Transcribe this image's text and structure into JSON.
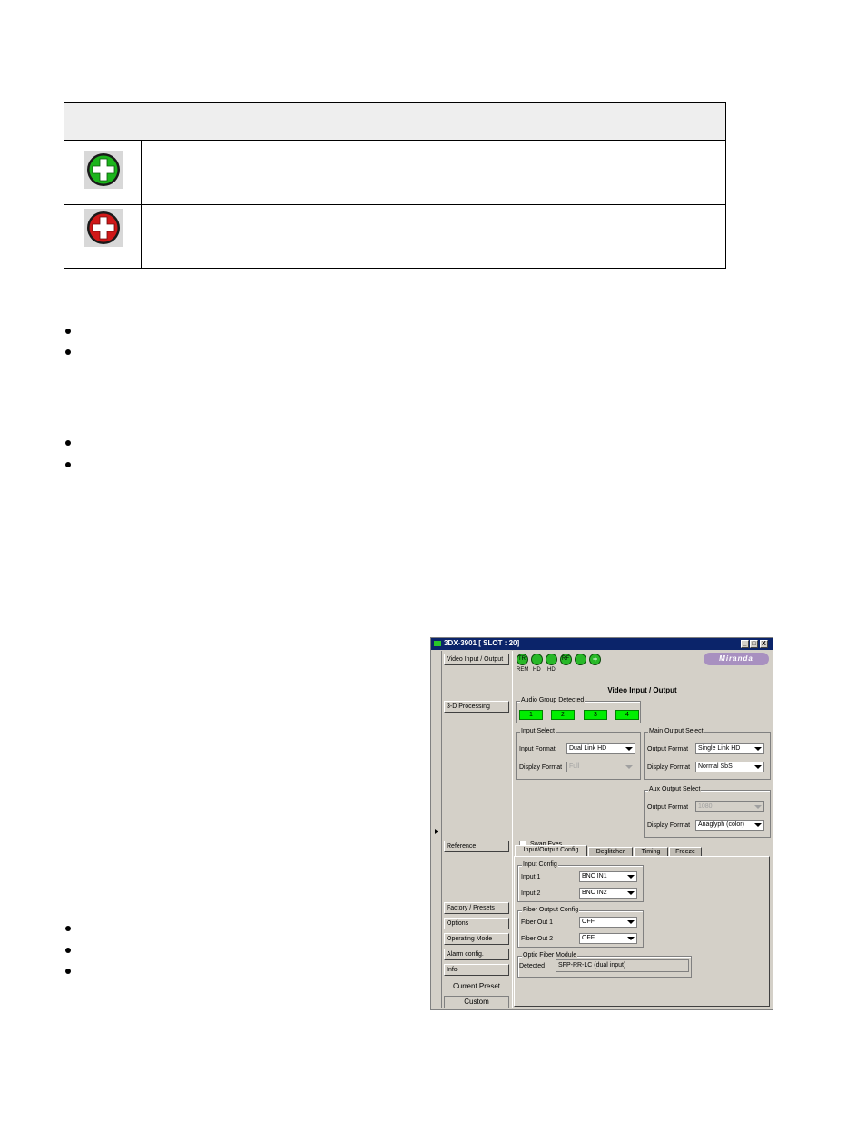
{
  "legend_table": {
    "rows": [
      {
        "icon": "green-plus-icon",
        "color": "#1cb51c"
      },
      {
        "icon": "red-plus-icon",
        "color": "#d01818"
      }
    ]
  },
  "window": {
    "title": "3DX-3901 [ SLOT : 20]",
    "controls": {
      "minimize": "_",
      "restore": "□",
      "close": "X"
    },
    "nav": {
      "items": [
        "Video Input / Output",
        "3-D Processing",
        "Reference",
        "Factory / Presets",
        "Options",
        "Operating Mode",
        "Alarm config.",
        "Info"
      ],
      "current_preset_label": "Current Preset",
      "current_preset_value": "Custom"
    },
    "status_leds": [
      {
        "text": "TR",
        "label": "REM"
      },
      {
        "text": "",
        "label": "HD"
      },
      {
        "text": "",
        "label": "HD"
      },
      {
        "text": "RF",
        "label": ""
      },
      {
        "text": "",
        "label": ""
      },
      {
        "text": "+",
        "label": ""
      }
    ],
    "brand": "Miranda",
    "section_title": "Video Input / Output",
    "audio_group": {
      "label": "Audio Group Detected",
      "groups": [
        "1",
        "2",
        "3",
        "4"
      ],
      "color": "#00ee00"
    },
    "input_select": {
      "label": "Input Select",
      "input_format_label": "Input Format",
      "input_format_value": "Dual Link HD",
      "display_format_label": "Display Format",
      "display_format_value": "Full"
    },
    "main_output_select": {
      "label": "Main Output Select",
      "output_format_label": "Output Format",
      "output_format_value": "Single Link HD",
      "display_format_label": "Display Format",
      "display_format_value": "Normal SbS"
    },
    "aux_output_select": {
      "label": "Aux Output Select",
      "output_format_label": "Output Format",
      "output_format_value": "1080i",
      "display_format_label": "Display Format",
      "display_format_value": "Anaglyph (color)"
    },
    "swap_eyes_label": "Swap Eyes",
    "tabs": [
      "Input/Output Config",
      "Deglitcher",
      "Timing",
      "Freeze"
    ],
    "input_config": {
      "label": "Input Config",
      "input1_label": "Input 1",
      "input1_value": "BNC IN1",
      "input2_label": "Input 2",
      "input2_value": "BNC IN2"
    },
    "fiber_output_config": {
      "label": "Fiber Output Config",
      "out1_label": "Fiber Out 1",
      "out1_value": "OFF",
      "out2_label": "Fiber Out 2",
      "out2_value": "OFF"
    },
    "optic_fiber_module": {
      "label": "Optic Fiber Module",
      "detected_label": "Detected",
      "detected_value": "SFP-RR-LC (dual input)"
    }
  }
}
